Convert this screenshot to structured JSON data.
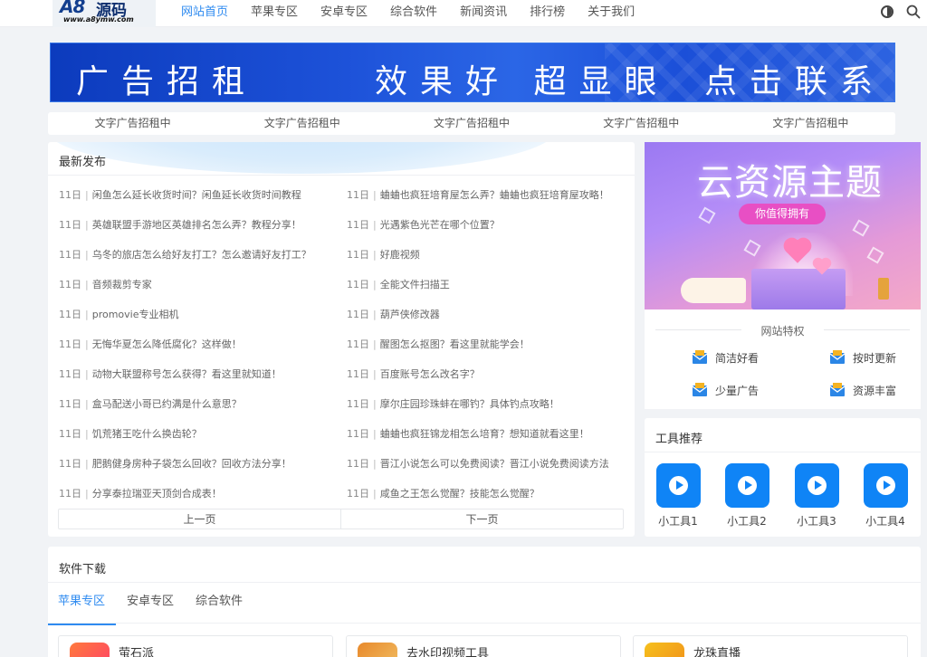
{
  "header": {
    "logo": {
      "brand": "A8",
      "brand_cn": "源码",
      "url": "www.a8ymw.com"
    },
    "nav": [
      "网站首页",
      "苹果专区",
      "安卓专区",
      "综合软件",
      "新闻资讯",
      "排行榜",
      "关于我们"
    ],
    "active_nav": "网站首页",
    "icons": [
      "theme-toggle-icon",
      "search-icon"
    ]
  },
  "banner": {
    "part1": "广告招租",
    "part2": "效果好 超显眼",
    "part3": "点击联系",
    "color": "#1645c2"
  },
  "text_ads": [
    "文字广告招租中",
    "文字广告招租中",
    "文字广告招租中",
    "文字广告招租中",
    "文字广告招租中"
  ],
  "latest": {
    "title": "最新发布",
    "left": [
      {
        "day": "11日",
        "title": "闲鱼怎么延长收货时间？闲鱼延长收货时间教程"
      },
      {
        "day": "11日",
        "title": "英雄联盟手游地区英雄排名怎么弄？教程分享！"
      },
      {
        "day": "11日",
        "title": "乌冬的旅店怎么给好友打工？怎么邀请好友打工？"
      },
      {
        "day": "11日",
        "title": "音频裁剪专家"
      },
      {
        "day": "11日",
        "title": "promovie专业相机"
      },
      {
        "day": "11日",
        "title": "无悔华夏怎么降低腐化？这样做！"
      },
      {
        "day": "11日",
        "title": "动物大联盟称号怎么获得？看这里就知道！"
      },
      {
        "day": "11日",
        "title": "盒马配送小哥已约满是什么意思？"
      },
      {
        "day": "11日",
        "title": "饥荒猪王吃什么换齿轮？"
      },
      {
        "day": "11日",
        "title": "肥鹅健身房种子袋怎么回收？回收方法分享！"
      },
      {
        "day": "11日",
        "title": "分享泰拉瑞亚天顶剑合成表！"
      }
    ],
    "right": [
      {
        "day": "11日",
        "title": "蛐蛐也疯狂培育屋怎么弄？蛐蛐也疯狂培育屋攻略！"
      },
      {
        "day": "11日",
        "title": "光遇紫色光芒在哪个位置？"
      },
      {
        "day": "11日",
        "title": "好鹿视频"
      },
      {
        "day": "11日",
        "title": "全能文件扫描王"
      },
      {
        "day": "11日",
        "title": "葫芦侠修改器"
      },
      {
        "day": "11日",
        "title": "醒图怎么抠图？看这里就能学会！"
      },
      {
        "day": "11日",
        "title": "百度账号怎么改名字？"
      },
      {
        "day": "11日",
        "title": "摩尔庄园珍珠蚌在哪钓？具体钓点攻略！"
      },
      {
        "day": "11日",
        "title": "蛐蛐也疯狂锦龙相怎么培育？想知道就看这里！"
      },
      {
        "day": "11日",
        "title": "晋江小说怎么可以免费阅读？晋江小说免费阅读方法"
      },
      {
        "day": "11日",
        "title": "咸鱼之王怎么觉醒？技能怎么觉醒？"
      }
    ],
    "prev": "上一页",
    "next": "下一页"
  },
  "promo": {
    "title": "云资源主题",
    "tagline": "你值得拥有"
  },
  "features": {
    "heading": "网站特权",
    "items": [
      "简洁好看",
      "按时更新",
      "少量广告",
      "资源丰富"
    ]
  },
  "tools": {
    "title": "工具推荐",
    "items": [
      "小工具1",
      "小工具2",
      "小工具3",
      "小工具4"
    ]
  },
  "software": {
    "title": "软件下载",
    "tabs": [
      "苹果专区",
      "安卓专区",
      "综合软件"
    ],
    "active_tab": "苹果专区",
    "cards": [
      "萤石派",
      "去水印视频工具",
      "龙珠直播"
    ]
  }
}
